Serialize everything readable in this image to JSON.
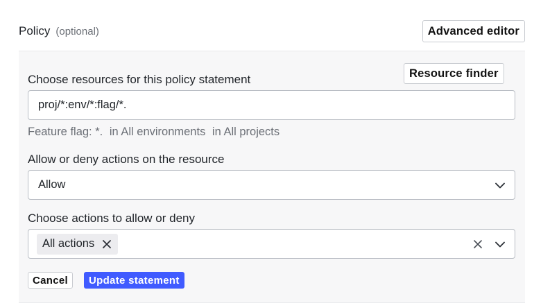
{
  "header": {
    "title": "Policy",
    "optional": "(optional)",
    "advanced_editor_label": "Advanced editor"
  },
  "resources": {
    "label": "Choose resources for this policy statement",
    "finder_label": "Resource finder",
    "value": "proj/*:env/*:flag/*.",
    "hint_parts": [
      "Feature flag: *.",
      "in All environments",
      "in All projects"
    ]
  },
  "effect": {
    "label": "Allow or deny actions on the resource",
    "selected": "Allow"
  },
  "actions": {
    "label": "Choose actions to allow or deny",
    "chips": [
      "All actions"
    ]
  },
  "buttons": {
    "cancel": "Cancel",
    "update": "Update statement"
  },
  "icons": {
    "chevron": "chevron-down-icon",
    "clear": "close-icon",
    "chip_remove": "close-icon"
  },
  "colors": {
    "primary": "#405bff",
    "panel_bg": "#f7f7f8",
    "muted_text": "#6b6f76"
  }
}
